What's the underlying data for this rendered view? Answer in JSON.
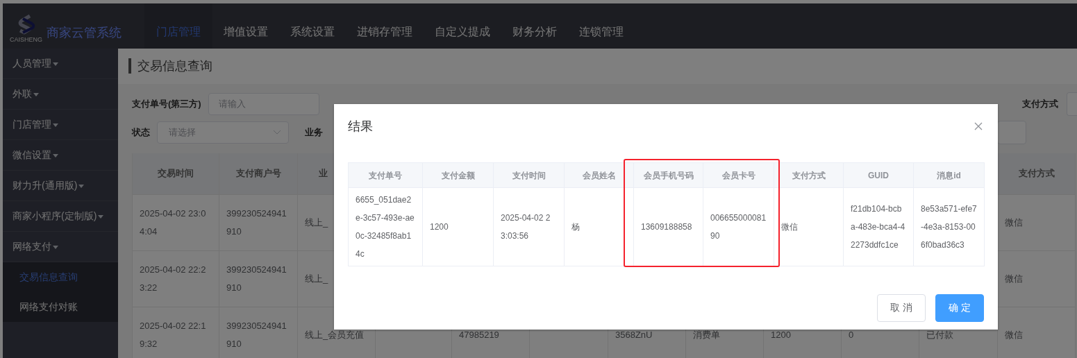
{
  "app": {
    "logo_caption": "CAISHENG",
    "title": "商家云管系统"
  },
  "top_nav": [
    {
      "label": "门店管理",
      "selected": true
    },
    {
      "label": "增值设置",
      "selected": false
    },
    {
      "label": "系统设置",
      "selected": false
    },
    {
      "label": "进销存管理",
      "selected": false
    },
    {
      "label": "自定义提成",
      "selected": false
    },
    {
      "label": "财务分析",
      "selected": false
    },
    {
      "label": "连锁管理",
      "selected": false
    }
  ],
  "sidebar": {
    "items": [
      {
        "label": "人员管理"
      },
      {
        "label": "外联"
      },
      {
        "label": "门店管理"
      },
      {
        "label": "微信设置"
      },
      {
        "label": "财力升(通用版)"
      },
      {
        "label": "商家小程序(定制版)"
      },
      {
        "label": "网络支付",
        "expanded": true,
        "children": [
          {
            "label": "交易信息查询",
            "selected": true
          },
          {
            "label": "网络支付对账",
            "selected": false
          }
        ]
      }
    ]
  },
  "page": {
    "title": "交易信息查询"
  },
  "filters": [
    [
      {
        "kind": "input",
        "label": "支付单号(第三方)",
        "placeholder": "请输入"
      },
      {
        "kind": "label",
        "label": "支付方式"
      }
    ],
    [
      {
        "kind": "select",
        "label": "状态",
        "placeholder": "请选择"
      },
      {
        "kind": "label",
        "label": "业务"
      }
    ]
  ],
  "table": {
    "columns": [
      {
        "label": "交易时间"
      },
      {
        "label": "支付商户号"
      },
      {
        "label": "业"
      },
      null,
      null,
      null,
      null,
      null,
      null,
      null,
      null,
      {
        "label": "支付方式"
      }
    ],
    "rows": [
      [
        "2025-04-02 23:04:04",
        "399230524941910",
        "线上_",
        null,
        null,
        null,
        null,
        null,
        null,
        null,
        null,
        "微信"
      ],
      [
        "2025-04-02 22:23:22",
        "399230524941910",
        "线上_",
        null,
        null,
        null,
        null,
        null,
        null,
        null,
        null,
        "微信"
      ],
      [
        "2025-04-02 22:19:32",
        "399230524941910",
        "线上_会员充值",
        null,
        "47985219",
        null,
        "3568ZnU",
        "消费单",
        "1200",
        "0",
        "已付款",
        "微信"
      ]
    ]
  },
  "dialog": {
    "title": "结果",
    "table": {
      "columns": [
        {
          "label": "支付单号",
          "highlighted": false
        },
        {
          "label": "支付金额",
          "highlighted": false
        },
        {
          "label": "支付时间",
          "highlighted": false
        },
        {
          "label": "会员姓名",
          "highlighted": false
        },
        {
          "label": "会员手机号码",
          "highlighted": true
        },
        {
          "label": "会员卡号",
          "highlighted": true
        },
        {
          "label": "支付方式",
          "highlighted": false
        },
        {
          "label": "GUID",
          "highlighted": false
        },
        {
          "label": "消息id",
          "highlighted": false
        }
      ],
      "rows": [
        [
          "6655_051dae2e-3c57-493e-ae0c-32485f8ab14c",
          "1200",
          "2025-04-02 23:03:56",
          "杨",
          "13609188858",
          "00665500008190",
          "微信",
          "f21db104-bcba-483e-bca4-42273ddfc1ce",
          "8e53a571-efe7-4e3a-8153-006f0bad36c3"
        ]
      ]
    },
    "buttons": [
      {
        "label": "取 消",
        "kind": "default"
      },
      {
        "label": "确 定",
        "kind": "primary"
      }
    ]
  }
}
